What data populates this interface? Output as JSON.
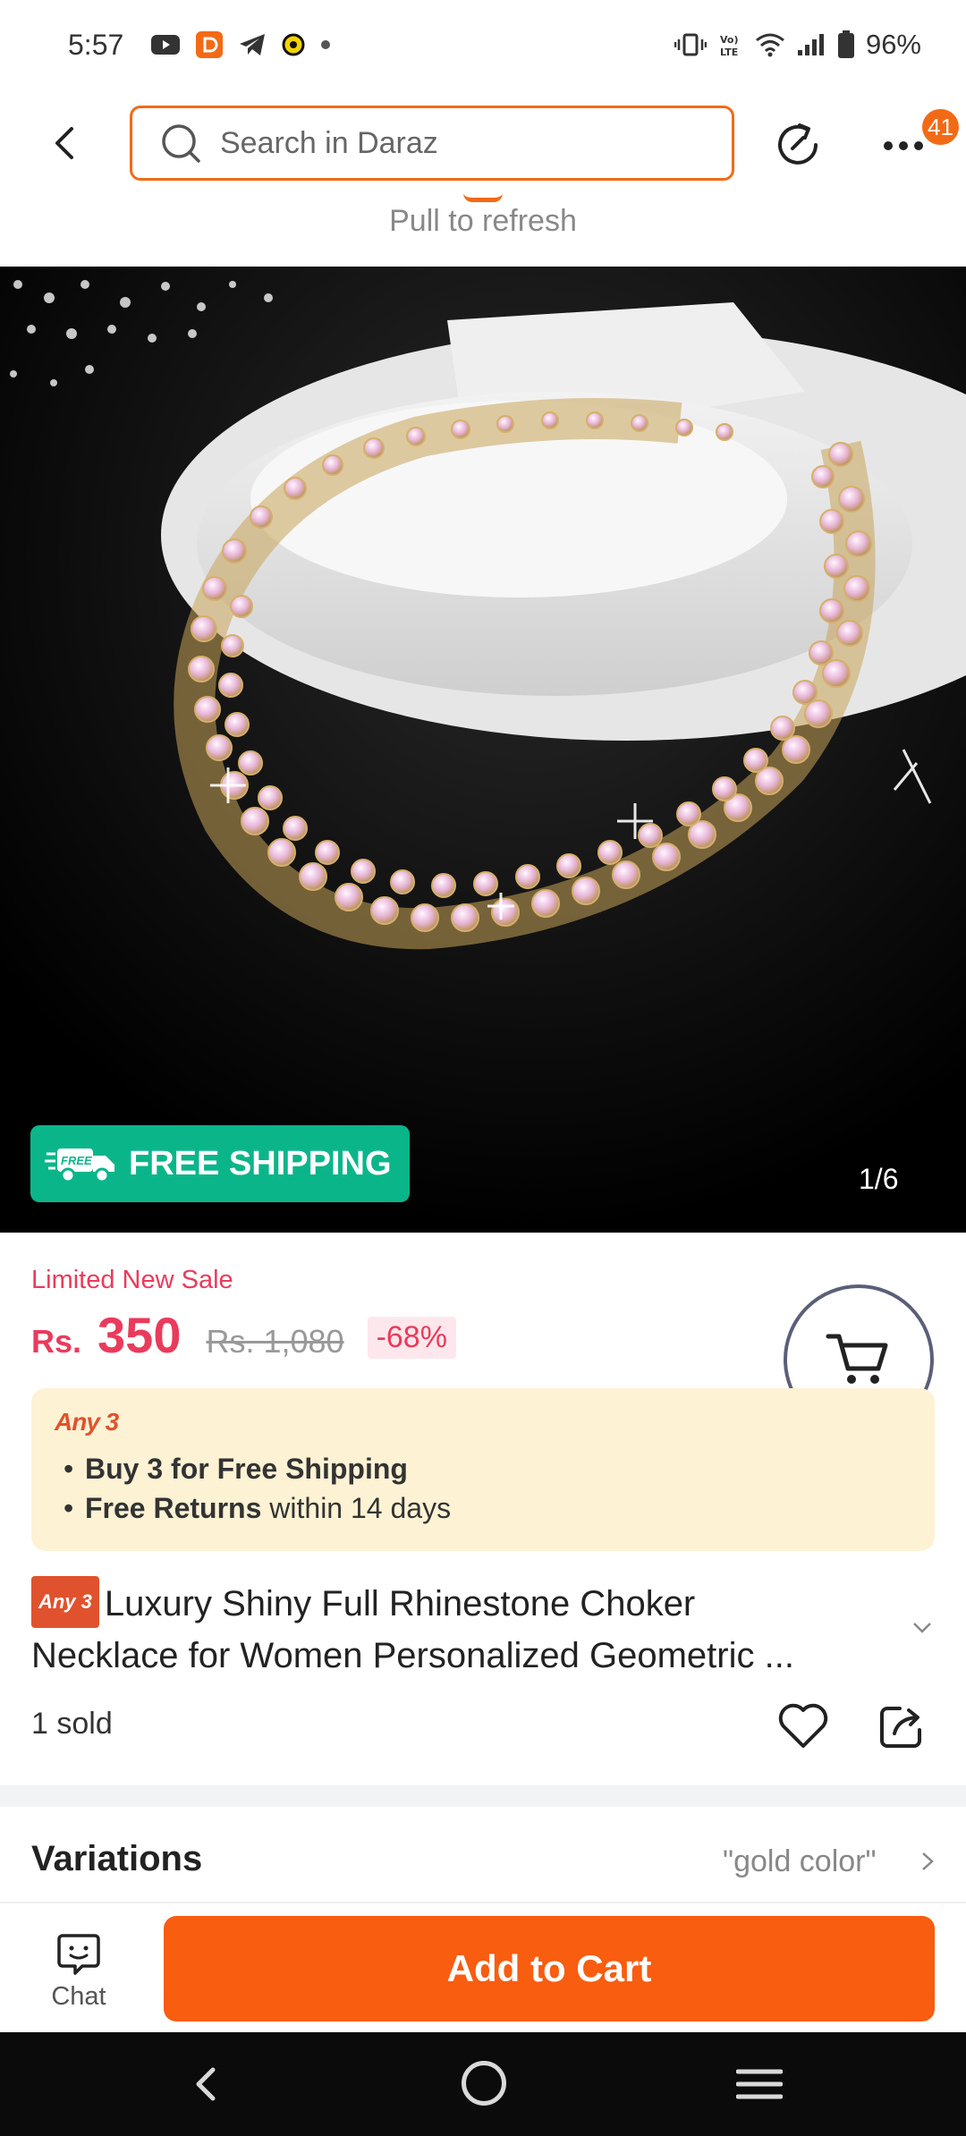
{
  "status_bar": {
    "time": "5:57",
    "battery": "96%",
    "left_icons": [
      "youtube-icon",
      "daraz-icon",
      "telegram-icon",
      "snapchat-icon",
      "dot-icon"
    ],
    "right_icons": [
      "vibrate-icon",
      "volte-icon",
      "wifi-icon",
      "signal-icon",
      "battery-icon"
    ]
  },
  "header": {
    "search_placeholder": "Search in Daraz",
    "cart_badge": "41"
  },
  "pull_to_refresh": "Pull to refresh",
  "gallery": {
    "free_shipping_badge": "FREE SHIPPING",
    "free_badge_small": "FREE",
    "counter": "1/6"
  },
  "pricing": {
    "sale_label": "Limited New Sale",
    "currency": "Rs.",
    "price": "350",
    "old_price": "Rs. 1,080",
    "discount": "-68%"
  },
  "promo": {
    "tag": "Any 3",
    "item1_bold": "Buy 3 for  Free Shipping",
    "item2_bold": "Free Returns",
    "item2_rest": " within 14 days"
  },
  "product": {
    "title_tag": "Any 3",
    "title_line1": "Luxury Shiny Full Rhinestone Choker",
    "title_line2": "Necklace for Women Personalized Geometric ...",
    "sold": "1 sold"
  },
  "variations": {
    "label": "Variations",
    "value": "\"gold color\""
  },
  "action_bar": {
    "chat_label": "Chat",
    "add_to_cart": "Add to Cart"
  },
  "colors": {
    "brand_orange": "#f85d10",
    "price_red": "#ea3b5c",
    "free_shipping_green": "#0bb58a",
    "promo_bg": "#fdf2d4"
  }
}
